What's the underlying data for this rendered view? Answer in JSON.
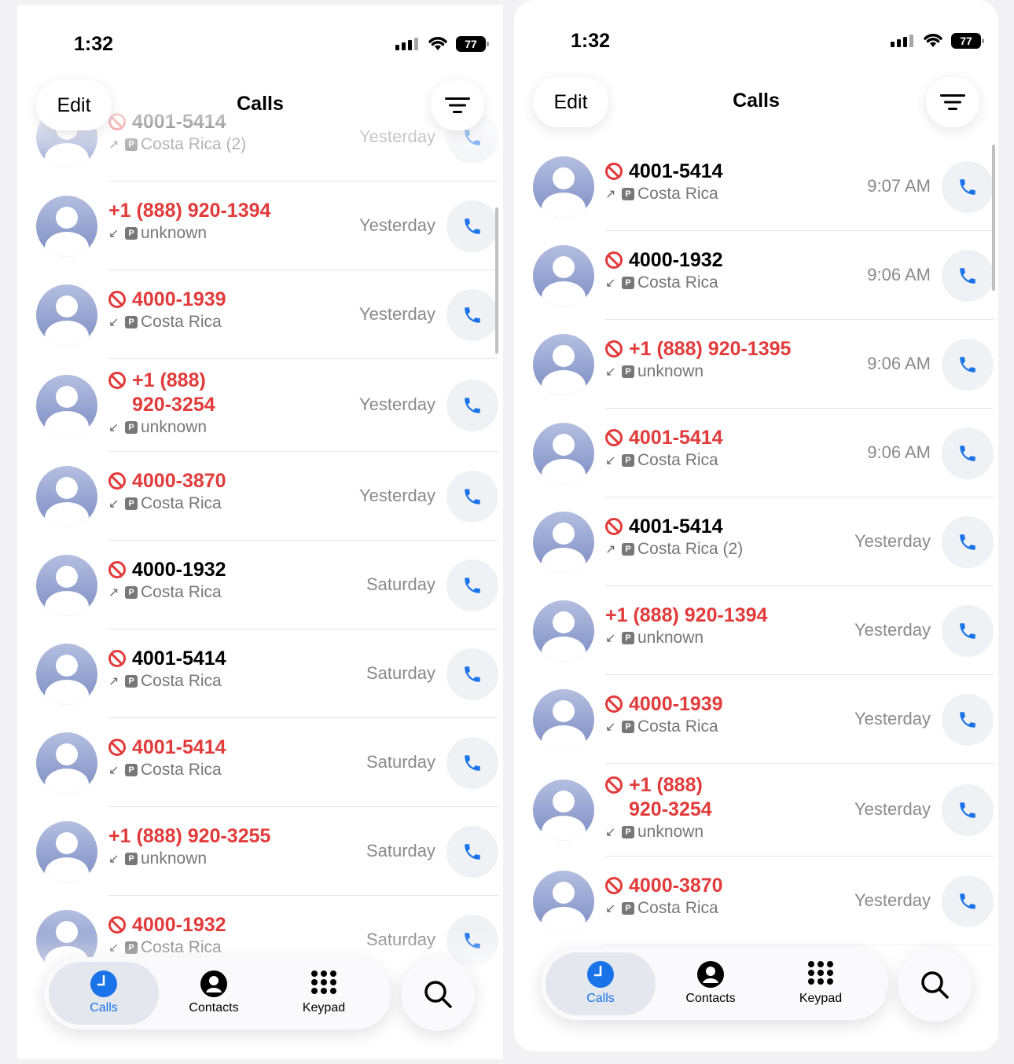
{
  "left": {
    "status": {
      "time": "1:32",
      "battery": "77"
    },
    "header": {
      "edit": "Edit",
      "title": "Calls"
    },
    "tabs": [
      {
        "label": "Calls",
        "active": true
      },
      {
        "label": "Contacts"
      },
      {
        "label": "Keypad"
      }
    ],
    "rows": [
      {
        "num": "4001-5414",
        "num2": "",
        "missed": false,
        "blocked": true,
        "dir": "↗",
        "sub": "Costa Rica (2)",
        "when": "Yesterday"
      },
      {
        "num": "+1 (888) 920-1394",
        "num2": "",
        "missed": true,
        "blocked": false,
        "dir": "↙",
        "sub": "unknown",
        "when": "Yesterday"
      },
      {
        "num": "4000-1939",
        "num2": "",
        "missed": true,
        "blocked": true,
        "dir": "↙",
        "sub": "Costa Rica",
        "when": "Yesterday"
      },
      {
        "num": "+1 (888)",
        "num2": "920-3254",
        "missed": true,
        "blocked": true,
        "dir": "↙",
        "sub": "unknown",
        "when": "Yesterday"
      },
      {
        "num": "4000-3870",
        "num2": "",
        "missed": true,
        "blocked": true,
        "dir": "↙",
        "sub": "Costa Rica",
        "when": "Yesterday"
      },
      {
        "num": "4000-1932",
        "num2": "",
        "missed": false,
        "blocked": true,
        "dir": "↗",
        "sub": "Costa Rica",
        "when": "Saturday"
      },
      {
        "num": "4001-5414",
        "num2": "",
        "missed": false,
        "blocked": true,
        "dir": "↗",
        "sub": "Costa Rica",
        "when": "Saturday"
      },
      {
        "num": "4001-5414",
        "num2": "",
        "missed": true,
        "blocked": true,
        "dir": "↙",
        "sub": "Costa Rica",
        "when": "Saturday"
      },
      {
        "num": "+1 (888) 920-3255",
        "num2": "",
        "missed": true,
        "blocked": false,
        "dir": "↙",
        "sub": "unknown",
        "when": "Saturday"
      },
      {
        "num": "4000-1932",
        "num2": "",
        "missed": true,
        "blocked": true,
        "dir": "↙",
        "sub": "Costa Rica",
        "when": "Saturday"
      }
    ]
  },
  "right": {
    "status": {
      "time": "1:32",
      "battery": "77"
    },
    "header": {
      "edit": "Edit",
      "title": "Calls"
    },
    "tabs": [
      {
        "label": "Calls",
        "active": true
      },
      {
        "label": "Contacts"
      },
      {
        "label": "Keypad"
      }
    ],
    "rows": [
      {
        "num": "4001-5414",
        "num2": "",
        "missed": false,
        "blocked": true,
        "dir": "↗",
        "sub": "Costa Rica",
        "when": "9:07 AM"
      },
      {
        "num": "4000-1932",
        "num2": "",
        "missed": false,
        "blocked": true,
        "dir": "↙",
        "sub": "Costa Rica",
        "when": "9:06 AM"
      },
      {
        "num": "+1 (888) 920-1395",
        "num2": "",
        "missed": true,
        "blocked": true,
        "dir": "↙",
        "sub": "unknown",
        "when": "9:06 AM"
      },
      {
        "num": "4001-5414",
        "num2": "",
        "missed": true,
        "blocked": true,
        "dir": "↙",
        "sub": "Costa Rica",
        "when": "9:06 AM"
      },
      {
        "num": "4001-5414",
        "num2": "",
        "missed": false,
        "blocked": true,
        "dir": "↗",
        "sub": "Costa Rica (2)",
        "when": "Yesterday"
      },
      {
        "num": "+1 (888) 920-1394",
        "num2": "",
        "missed": true,
        "blocked": false,
        "dir": "↙",
        "sub": "unknown",
        "when": "Yesterday"
      },
      {
        "num": "4000-1939",
        "num2": "",
        "missed": true,
        "blocked": true,
        "dir": "↙",
        "sub": "Costa Rica",
        "when": "Yesterday"
      },
      {
        "num": "+1 (888)",
        "num2": "920-3254",
        "missed": true,
        "blocked": true,
        "dir": "↙",
        "sub": "unknown",
        "when": "Yesterday"
      },
      {
        "num": "4000-3870",
        "num2": "",
        "missed": true,
        "blocked": true,
        "dir": "↙",
        "sub": "Costa Rica",
        "when": "Yesterday"
      }
    ]
  },
  "icons": {
    "avatar": "person-avatar-icon",
    "call": "phone-icon",
    "blocked": "blocked-icon",
    "filter": "filter-lines-icon",
    "search": "search-icon"
  },
  "colors": {
    "missed": "#e23b3b",
    "accent": "#1a73e8"
  }
}
